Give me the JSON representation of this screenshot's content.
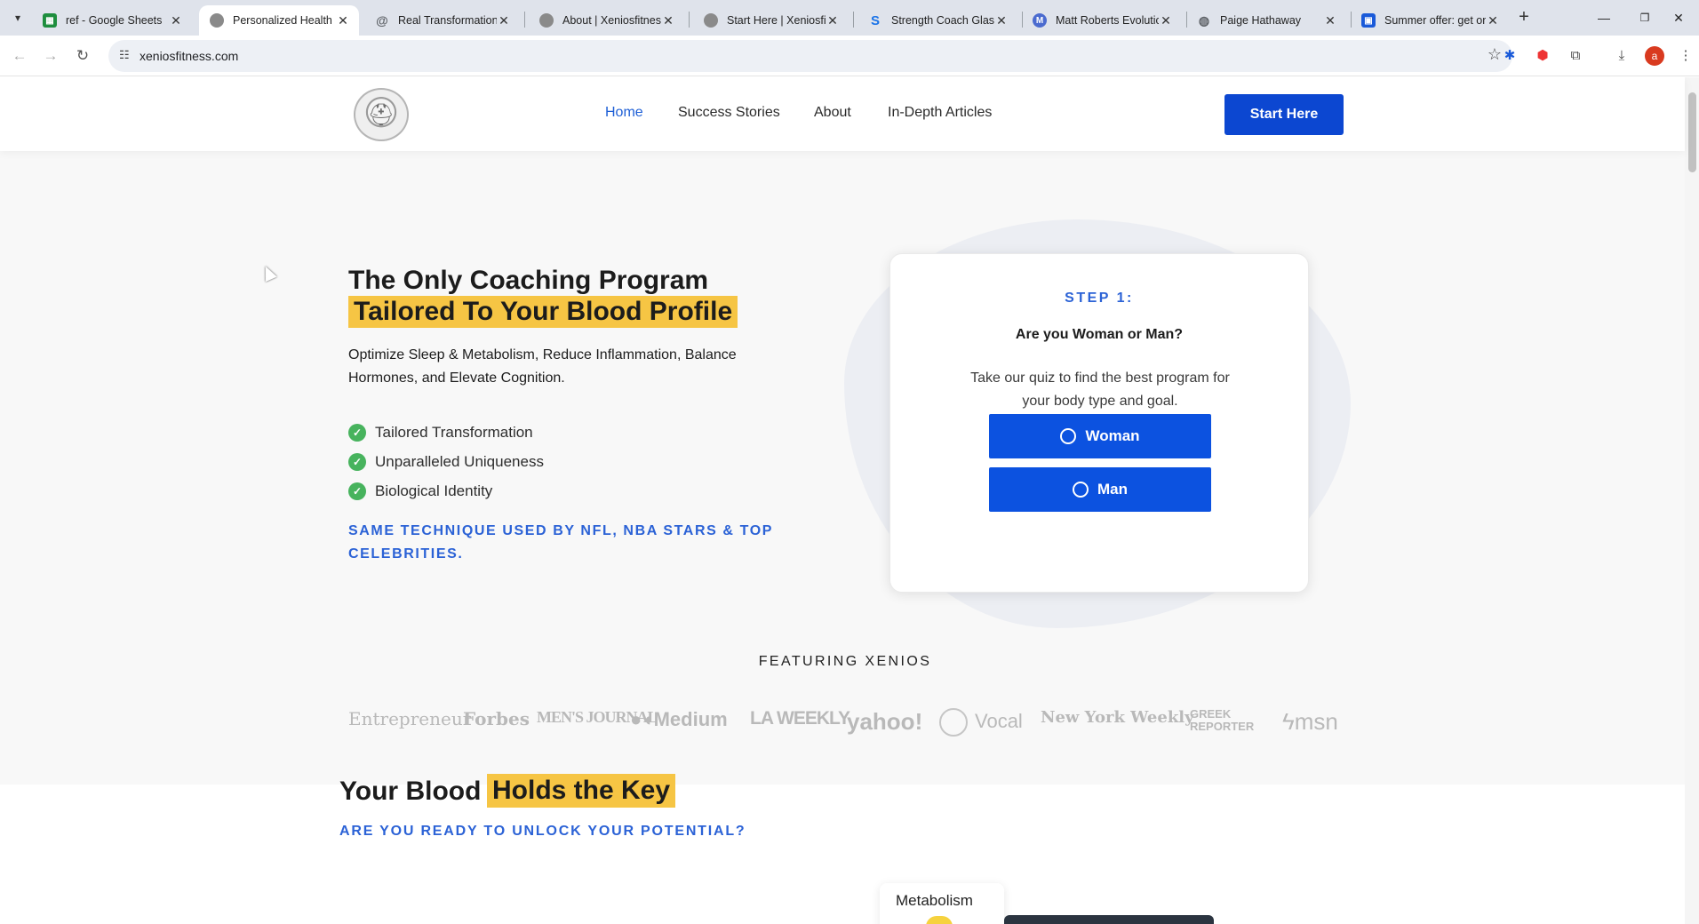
{
  "browser": {
    "tabs": [
      {
        "title": "ref - Google Sheets",
        "icon": "google-sheets-icon",
        "color": "#1e8e3e",
        "active": false
      },
      {
        "title": "Personalized Health C",
        "icon": "spartan-helmet-icon",
        "color": "#8a8a8a",
        "active": true
      },
      {
        "title": "Real Transformations:",
        "icon": "spiral-icon",
        "color": "#5f6368",
        "active": false
      },
      {
        "title": "About | Xeniosfitness",
        "icon": "spartan-helmet-icon",
        "color": "#8a8a8a",
        "active": false
      },
      {
        "title": "Start Here | Xeniosfitn",
        "icon": "spartan-helmet-icon",
        "color": "#8a8a8a",
        "active": false
      },
      {
        "title": "Strength Coach Glasg",
        "icon": "s-logo-icon",
        "color": "#1a73e8",
        "active": false
      },
      {
        "title": "Matt Roberts Evolutic",
        "icon": "mr-logo-icon",
        "color": "#4b6bcf",
        "active": false
      },
      {
        "title": "Paige Hathaway",
        "icon": "globe-icon",
        "color": "#5f6368",
        "active": false
      },
      {
        "title": "Summer offer: get on",
        "icon": "blue-app-icon",
        "color": "#1a5ad9",
        "active": false
      }
    ],
    "url": "xeniosfitness.com",
    "profile_initial": "a"
  },
  "site": {
    "nav": [
      "Home",
      "Success Stories",
      "About",
      "In-Depth Articles"
    ],
    "cta": "Start Here"
  },
  "hero": {
    "title_line1": "The Only Coaching Program",
    "title_line2": "Tailored To Your Blood Profile",
    "subtitle": "Optimize Sleep & Metabolism, Reduce Inflammation, Balance Hormones, and Elevate Cognition.",
    "bullets": [
      "Tailored Transformation",
      "Unparalleled Uniqueness",
      "Biological Identity"
    ],
    "tagline": "SAME TECHNIQUE USED BY NFL, NBA STARS & TOP CELEBRITIES."
  },
  "quiz": {
    "step": "STEP 1:",
    "question": "Are you Woman or Man?",
    "description": "Take our quiz to find the best program for your body type and goal.",
    "options": [
      "Woman",
      "Man"
    ]
  },
  "featuring": {
    "heading": "FEATURING XENIOS",
    "outlets": [
      "Entrepreneur",
      "Forbes",
      "MEN'S JOURNAL",
      "Medium",
      "LA WEEKLY",
      "yahoo!",
      "Vocal",
      "New York Weekly",
      "GREEK REPORTER",
      "msn"
    ]
  },
  "section2": {
    "title_plain": "Your Blood",
    "title_highlight": "Holds the Key",
    "tagline": "ARE YOU READY TO UNLOCK YOUR POTENTIAL?",
    "card_label": "Metabolism"
  },
  "colors": {
    "accent_blue": "#0c47d1",
    "highlight_yellow": "#f6c544",
    "check_green": "#47b35d"
  }
}
